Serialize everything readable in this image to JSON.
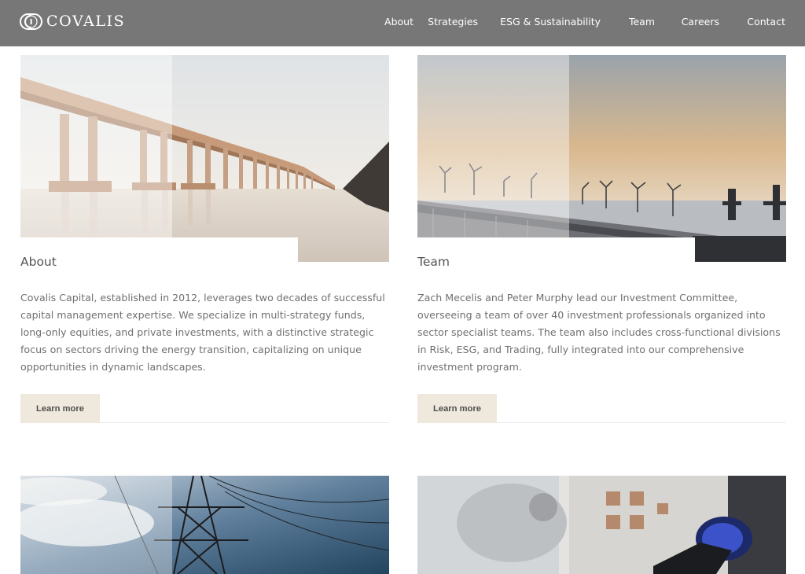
{
  "header": {
    "brand": "COVALIS",
    "nav": [
      {
        "label": "About"
      },
      {
        "label": "Strategies"
      },
      {
        "label": "ESG & Sustainability"
      },
      {
        "label": "Team"
      },
      {
        "label": "Careers"
      },
      {
        "label": "Contact"
      }
    ]
  },
  "cards": [
    {
      "title": "About",
      "description": "Covalis Capital, established in 2012, leverages two decades of successful capital management expertise. We specialize in multi-strategy funds, long-only equities, and private investments, with a distinctive strategic focus on sectors driving the energy transition, capitalizing on unique opportunities in dynamic landscapes.",
      "button": "Learn more"
    },
    {
      "title": "Team",
      "description": "Zach Mecelis and Peter Murphy lead our Investment Committee, overseeing a team of over 40 investment professionals organized into sector specialist teams. The team also includes cross-functional divisions in Risk, ESG, and Trading, fully integrated into our comprehensive investment program.",
      "button": "Learn more"
    }
  ],
  "colors": {
    "header_bg": "#777777",
    "button_bg": "#efe8dc",
    "body_text": "#707070"
  }
}
